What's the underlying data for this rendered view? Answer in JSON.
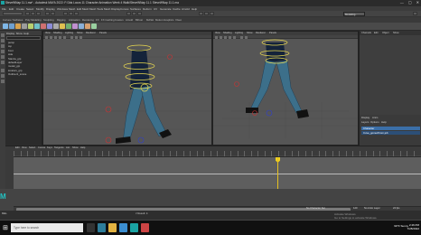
{
  "window": {
    "title": "SteveWNap 11.1.ma* - Autodesk MAYA 2022: F:\\3ds Locos 11 Character Animation Week 4 Walk\\SteveWNap 11.1 SteveWNap 11.1.ma",
    "controls": [
      "—",
      "▢",
      "✕"
    ]
  },
  "menubar": [
    "File",
    "Edit",
    "Create",
    "Select",
    "Modify",
    "Display",
    "Windows",
    "Mesh",
    "Edit Mesh",
    "Mesh Tools",
    "Mesh Display",
    "Curves",
    "Surfaces",
    "Deform",
    "UV",
    "Generate",
    "Cache",
    "Arnold",
    "Help"
  ],
  "statusline": {
    "workspace": "Modeling-Standard"
  },
  "shelf": {
    "tabs": [
      "Curves / Surfaces",
      "Poly Modeling",
      "Sculpting",
      "Rigging",
      "Animation",
      "Rendering",
      "FX",
      "FX Caching",
      "Custom",
      "Arnold",
      "Bifrost",
      "MASH",
      "Motion Graphics",
      "XGen"
    ]
  },
  "outliner": {
    "menu": [
      "Display",
      "Show",
      "Help"
    ],
    "items": [
      "persp",
      "top",
      "front",
      "side",
      "Stanza_grp",
      "defaultLayer",
      "model_grp",
      "locators_grp",
      "Outliner1_scene"
    ]
  },
  "viewport_left": {
    "menu": [
      "View",
      "Shading",
      "Lighting",
      "Show",
      "Renderer",
      "Panels"
    ]
  },
  "viewport_right": {
    "menu": [
      "View",
      "Shading",
      "Lighting",
      "Show",
      "Renderer",
      "Panels"
    ]
  },
  "right_panel": {
    "tabs": [
      "Channels",
      "Edit",
      "Object",
      "Show"
    ],
    "layer_tabs": [
      "Display",
      "Anim"
    ],
    "layer_menu": [
      "Layers",
      "Options",
      "Help"
    ],
    "layers": [
      {
        "name": "Character",
        "color": "#3b6fa8"
      },
      {
        "name": "Cuve_gomezFrom.job",
        "color": "#2c4f78"
      }
    ]
  },
  "graph_editor": {
    "menu": [
      "Edit",
      "View",
      "Select",
      "Curves",
      "Keys",
      "Tangents",
      "List",
      "Show",
      "Help"
    ],
    "current_frame": 64
  },
  "range": {
    "end": "120",
    "fps": "24 fps",
    "char_set": "No Character Set",
    "anim_layer": "No Anim Layer"
  },
  "cmdline": {
    "lang": "MEL",
    "result": "// Result: 4"
  },
  "activate_windows": {
    "line1": "Activate Windows",
    "line2": "Go to Settings to activate Windows."
  },
  "taskbar": {
    "search_placeholder": "Type here to search",
    "weather": "99°F Sunny",
    "time": "2:46 PM",
    "date": "7/28/2022"
  }
}
